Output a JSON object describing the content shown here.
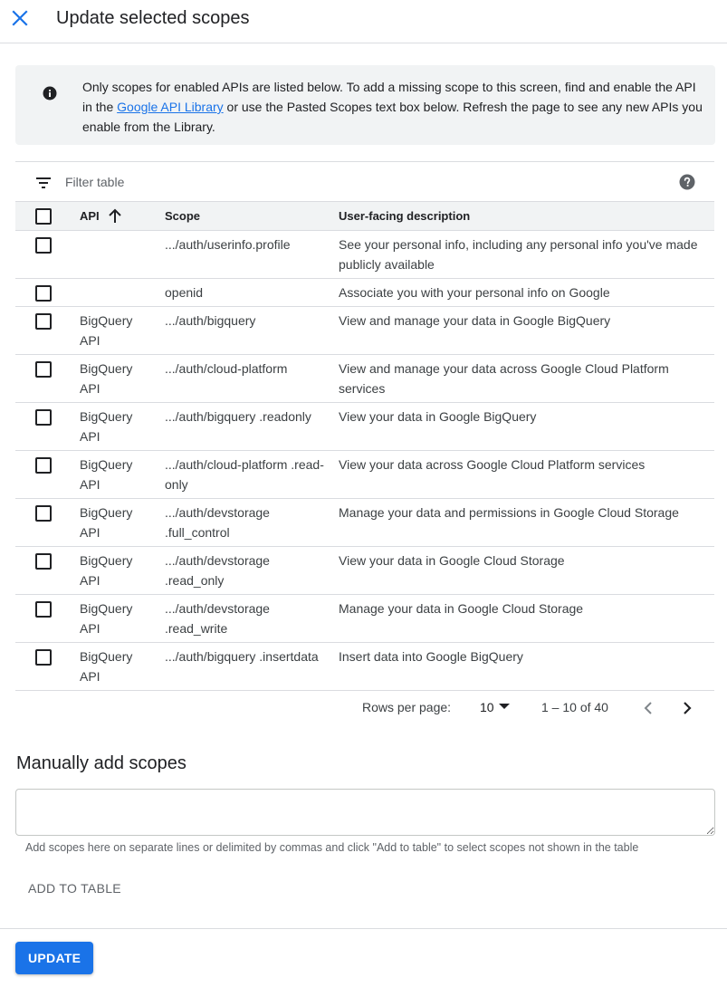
{
  "header": {
    "title": "Update selected scopes",
    "close_icon": "close-icon"
  },
  "banner": {
    "text_before": "Only scopes for enabled APIs are listed below. To add a missing scope to this screen, find and enable the API in the ",
    "link": "Google API Library",
    "text_after": " or use the Pasted Scopes text box below. Refresh the page to see any new APIs you enable from the Library.",
    "icon": "info-icon"
  },
  "filter": {
    "placeholder": "Filter table",
    "icon": "filter-icon",
    "help_icon": "help-icon"
  },
  "table": {
    "columns": {
      "api": "API",
      "scope": "Scope",
      "description": "User-facing description"
    },
    "sort_icon": "arrow-up-icon",
    "rows": [
      {
        "api": "",
        "scope": ".../auth/userinfo.profile",
        "description": "See your personal info, including any personal info you've made publicly available"
      },
      {
        "api": "",
        "scope": "openid",
        "description": "Associate you with your personal info on Google"
      },
      {
        "api": "BigQuery API",
        "scope": ".../auth/bigquery",
        "description": "View and manage your data in Google BigQuery"
      },
      {
        "api": "BigQuery API",
        "scope": ".../auth/cloud-platform",
        "description": "View and manage your data across Google Cloud Platform services"
      },
      {
        "api": "BigQuery API",
        "scope": ".../auth/bigquery .readonly",
        "description": "View your data in Google BigQuery"
      },
      {
        "api": "BigQuery API",
        "scope": ".../auth/cloud-platform .read-only",
        "description": "View your data across Google Cloud Platform services"
      },
      {
        "api": "BigQuery API",
        "scope": ".../auth/devstorage .full_control",
        "description": "Manage your data and permissions in Google Cloud Storage"
      },
      {
        "api": "BigQuery API",
        "scope": ".../auth/devstorage .read_only",
        "description": "View your data in Google Cloud Storage"
      },
      {
        "api": "BigQuery API",
        "scope": ".../auth/devstorage .read_write",
        "description": "Manage your data in Google Cloud Storage"
      },
      {
        "api": "BigQuery API",
        "scope": ".../auth/bigquery .insertdata",
        "description": "Insert data into Google BigQuery"
      }
    ]
  },
  "pagination": {
    "rows_per_page_label": "Rows per page:",
    "rows_per_page": "10",
    "range": "1 – 10 of 40",
    "prev_icon": "chevron-left-icon",
    "next_icon": "chevron-right-icon"
  },
  "manual": {
    "title": "Manually add scopes",
    "textarea_value": "",
    "helper": "Add scopes here on separate lines or delimited by commas and click \"Add to table\" to select scopes not shown in the table",
    "add_button": "ADD TO TABLE"
  },
  "footer": {
    "update_button": "UPDATE"
  },
  "colors": {
    "accent": "#1a73e8",
    "banner_bg": "#f1f3f4",
    "divider": "#dadce0"
  }
}
